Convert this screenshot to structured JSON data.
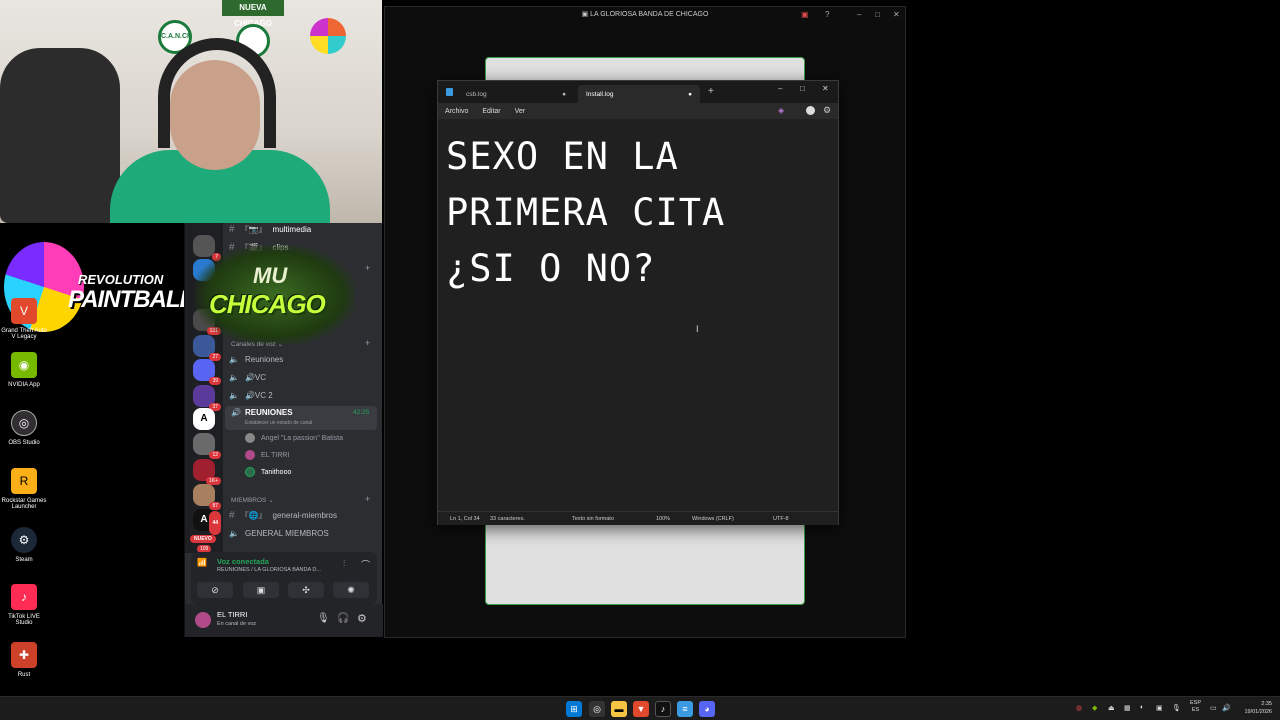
{
  "webcam": {
    "sign": "NUEVA CHICAGO",
    "badge": "C.A.N.CH"
  },
  "desktop_icons": [
    {
      "label": "Grand Theft Auto V Legacy",
      "icon": "gta-icon",
      "color": "#e0492b"
    },
    {
      "label": "NVIDIA App",
      "icon": "nvidia-icon",
      "color": "#76b900"
    },
    {
      "label": "OBS Studio",
      "icon": "obs-icon",
      "color": "#302e31"
    },
    {
      "label": "Rockstar Games Launcher",
      "icon": "rockstar-icon",
      "color": "#fcaf17"
    },
    {
      "label": "Steam",
      "icon": "steam-icon",
      "color": "#1b2838"
    },
    {
      "label": "TikTok LIVE Studio",
      "icon": "tiktok-icon",
      "color": "#fe2c55"
    },
    {
      "label": "Rust",
      "icon": "rust-icon",
      "color": "#cd412b"
    }
  ],
  "overlay_logo": {
    "line1": "REVOLUTION",
    "line2": "PAINTBALL"
  },
  "discord": {
    "server_logo": {
      "line1": "MU",
      "line2": "CHICAGO"
    },
    "server_badges": [
      "7",
      "131",
      "27",
      "39",
      "37",
      "12",
      "1K+",
      "87",
      "44",
      "109"
    ],
    "channels_top": [
      {
        "label": "multimedia",
        "prefix": "『📷』"
      },
      {
        "label": "clips",
        "prefix": "『🎬』"
      }
    ],
    "voice_category": "Canales de voz",
    "voice_channels": [
      {
        "label": "Reuniones"
      },
      {
        "label": "🔊VC"
      },
      {
        "label": "🔊VC 2"
      }
    ],
    "active_channel": {
      "label": "REUNIONES",
      "time": "42:25",
      "status": "Establecer un estado de canal"
    },
    "voice_users": [
      {
        "name": "Angel \"La passion\" Batista"
      },
      {
        "name": "EL TIRRI"
      },
      {
        "name": "Tanithooo"
      }
    ],
    "members_category": "MIEMBROS",
    "member_channels": [
      {
        "label": "general-miembros",
        "prefix": "『🌐』"
      },
      {
        "label": "GENERAL MIEMBROS",
        "prefix": ""
      }
    ],
    "new_badge": "NUEVO",
    "voice_connected": {
      "title": "Voz conectada",
      "subtitle": "REUNIONES / LA GLORIOSA BANDA D..."
    },
    "user": {
      "name": "EL TIRRI",
      "status": "En canal de voz"
    }
  },
  "main_window": {
    "title": "LA GLORIOSA BANDA DE CHICAGO"
  },
  "notepad": {
    "tabs": [
      {
        "label": "csb.log",
        "active": false
      },
      {
        "label": "Install.log",
        "active": true
      }
    ],
    "menu": [
      "Archivo",
      "Editar",
      "Ver"
    ],
    "text": "SEXO EN LA\nPRIMERA CITA\n¿SI O NO?",
    "status": {
      "position": "Ln 1, Col 34",
      "chars": "33 caracteres.",
      "format": "Texto sin formato",
      "zoom": "100%",
      "line_endings": "Windows (CRLF)",
      "encoding": "UTF-8"
    }
  },
  "taskbar": {
    "lang": "ESP",
    "lang2": "ES",
    "time": "2:35",
    "date": "19/01/2026"
  }
}
